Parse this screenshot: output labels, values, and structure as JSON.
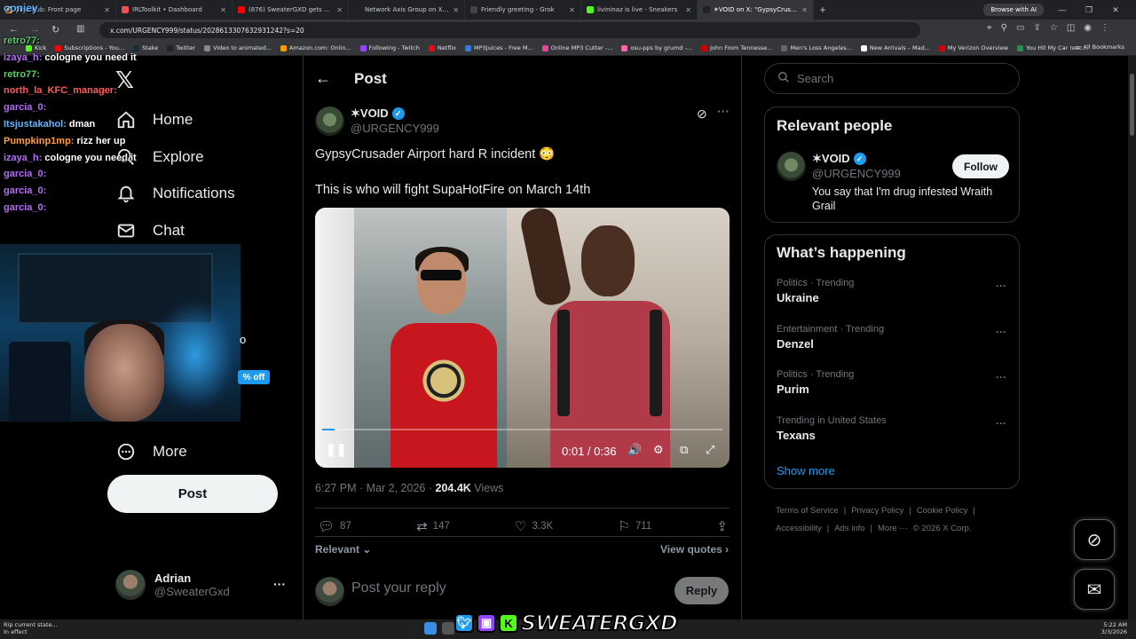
{
  "browser": {
    "tabs": [
      {
        "title": "JagerRob: Front page",
        "color": "#e0a030",
        "active": false
      },
      {
        "title": "IRLToolkit • Dashboard",
        "color": "#f05050",
        "active": false
      },
      {
        "title": "(876) SweaterGXD gets pressed",
        "color": "#ff0000",
        "active": false
      },
      {
        "title": "Network Axis Group on X: \"This",
        "color": "#222222",
        "active": false
      },
      {
        "title": "Friendly greeting - Grok",
        "color": "#444444",
        "active": false
      },
      {
        "title": "livininaz is live - Sneakers",
        "color": "#53fc18",
        "active": false
      },
      {
        "title": "✶VOID on X: \"GypsyCrusader",
        "color": "#222222",
        "active": true
      }
    ],
    "browse_ai": "Browse with AI",
    "url": "x.com/URGENCY999/status/2028613307632931242?s=20",
    "bookmarks": [
      {
        "label": "Kick",
        "color": "#53fc18"
      },
      {
        "label": "Subscriptions - You...",
        "color": "#ff0000"
      },
      {
        "label": "Stake",
        "color": "#1a2c38"
      },
      {
        "label": "Twitter",
        "color": "#222222"
      },
      {
        "label": "Video to animated...",
        "color": "#888888"
      },
      {
        "label": "Amazon.com: Onlin...",
        "color": "#ff9900"
      },
      {
        "label": "Following - Twitch",
        "color": "#9146ff"
      },
      {
        "label": "Netflix",
        "color": "#e50914"
      },
      {
        "label": "MP3Juices - Free M...",
        "color": "#3a7bd5"
      },
      {
        "label": "Online MP3 Cutter -...",
        "color": "#e84393"
      },
      {
        "label": "osu-pps by grumd -...",
        "color": "#ff66aa"
      },
      {
        "label": "John From Tennesse...",
        "color": "#cc0000"
      },
      {
        "label": "Men's Loss Angeles...",
        "color": "#666666"
      },
      {
        "label": "New Arrivals – Mad...",
        "color": "#ffffff"
      },
      {
        "label": "My Verizon Overview",
        "color": "#cd040b"
      },
      {
        "label": "You Hit My Car reac...",
        "color": "#2e8b57"
      }
    ],
    "all_bookmarks": "All Bookmarks"
  },
  "chat": {
    "top": "ooniey",
    "lines": [
      {
        "user": "retro77:",
        "msg": "",
        "color": "#56d364"
      },
      {
        "user": "izaya_h:",
        "msg": "cologne you need it",
        "color": "#b56cf7"
      },
      {
        "user": "retro77:",
        "msg": "",
        "color": "#56d364"
      },
      {
        "user": "north_la_KFC_manager:",
        "msg": "",
        "color": "#ff5a5a"
      },
      {
        "user": "garcia_0:",
        "msg": "",
        "color": "#b56cf7"
      },
      {
        "user": "Itsjustakahol:",
        "msg": "dman",
        "color": "#5fb4ff"
      },
      {
        "user": "Pumpkinp1mp:",
        "msg": "rizz her up",
        "color": "#ff9e3d"
      },
      {
        "user": "izaya_h:",
        "msg": "cologne you need it",
        "color": "#b56cf7"
      },
      {
        "user": "garcia_0:",
        "msg": "",
        "color": "#b56cf7"
      },
      {
        "user": "garcia_0:",
        "msg": "",
        "color": "#b56cf7"
      },
      {
        "user": "garcia_0:",
        "msg": "",
        "color": "#b56cf7"
      }
    ],
    "off_badge": "% off",
    "letter": "o"
  },
  "nav": {
    "home": "Home",
    "explore": "Explore",
    "notifications": "Notifications",
    "chat": "Chat",
    "more": "More",
    "post": "Post",
    "profile_name": "Adrian",
    "profile_handle": "@SweaterGxd"
  },
  "post": {
    "header": "Post",
    "author_name": "✶VOID",
    "author_handle": "@URGENCY999",
    "text1": "GypsyCrusader Airport hard R incident 😳",
    "text2": "This is who will fight SupaHotFire on March 14th",
    "video_time": "0:01 / 0:36",
    "video_progress": 0.03,
    "timestamp": "6:27 PM · Mar 2, 2026 · ",
    "views": "204.4K",
    "views_label": " Views",
    "replies": "87",
    "reposts": "147",
    "likes": "3.3K",
    "bookmarks": "711",
    "sort": "Relevant",
    "view_quotes": "View quotes",
    "reply_placeholder": "Post your reply",
    "reply_button": "Reply"
  },
  "right": {
    "search_placeholder": "Search",
    "relevant_title": "Relevant people",
    "person_name": "✶VOID",
    "person_handle": "@URGENCY999",
    "follow": "Follow",
    "person_bio": "You say that I'm drug infested Wraith Grail",
    "happening_title": "What’s happening",
    "trends": [
      {
        "context": "Politics · Trending",
        "title": "Ukraine"
      },
      {
        "context": "Entertainment · Trending",
        "title": "Denzel"
      },
      {
        "context": "Politics · Trending",
        "title": "Purim"
      },
      {
        "context": "Trending in United States",
        "title": "Texans"
      }
    ],
    "show_more": "Show more",
    "footer1": [
      "Terms of Service",
      "|",
      "Privacy Policy",
      "|",
      "Cookie Policy",
      "|"
    ],
    "footer2": [
      "Accessibility",
      "|",
      "Ads info",
      "|",
      "More ···",
      "© 2026 X Corp."
    ]
  },
  "taskbar": {
    "notice1": "Rip current state...",
    "notice2": "In effect",
    "time": "5:22 AM",
    "date": "3/3/2026"
  },
  "stream_banner": "SWEATERGXD"
}
